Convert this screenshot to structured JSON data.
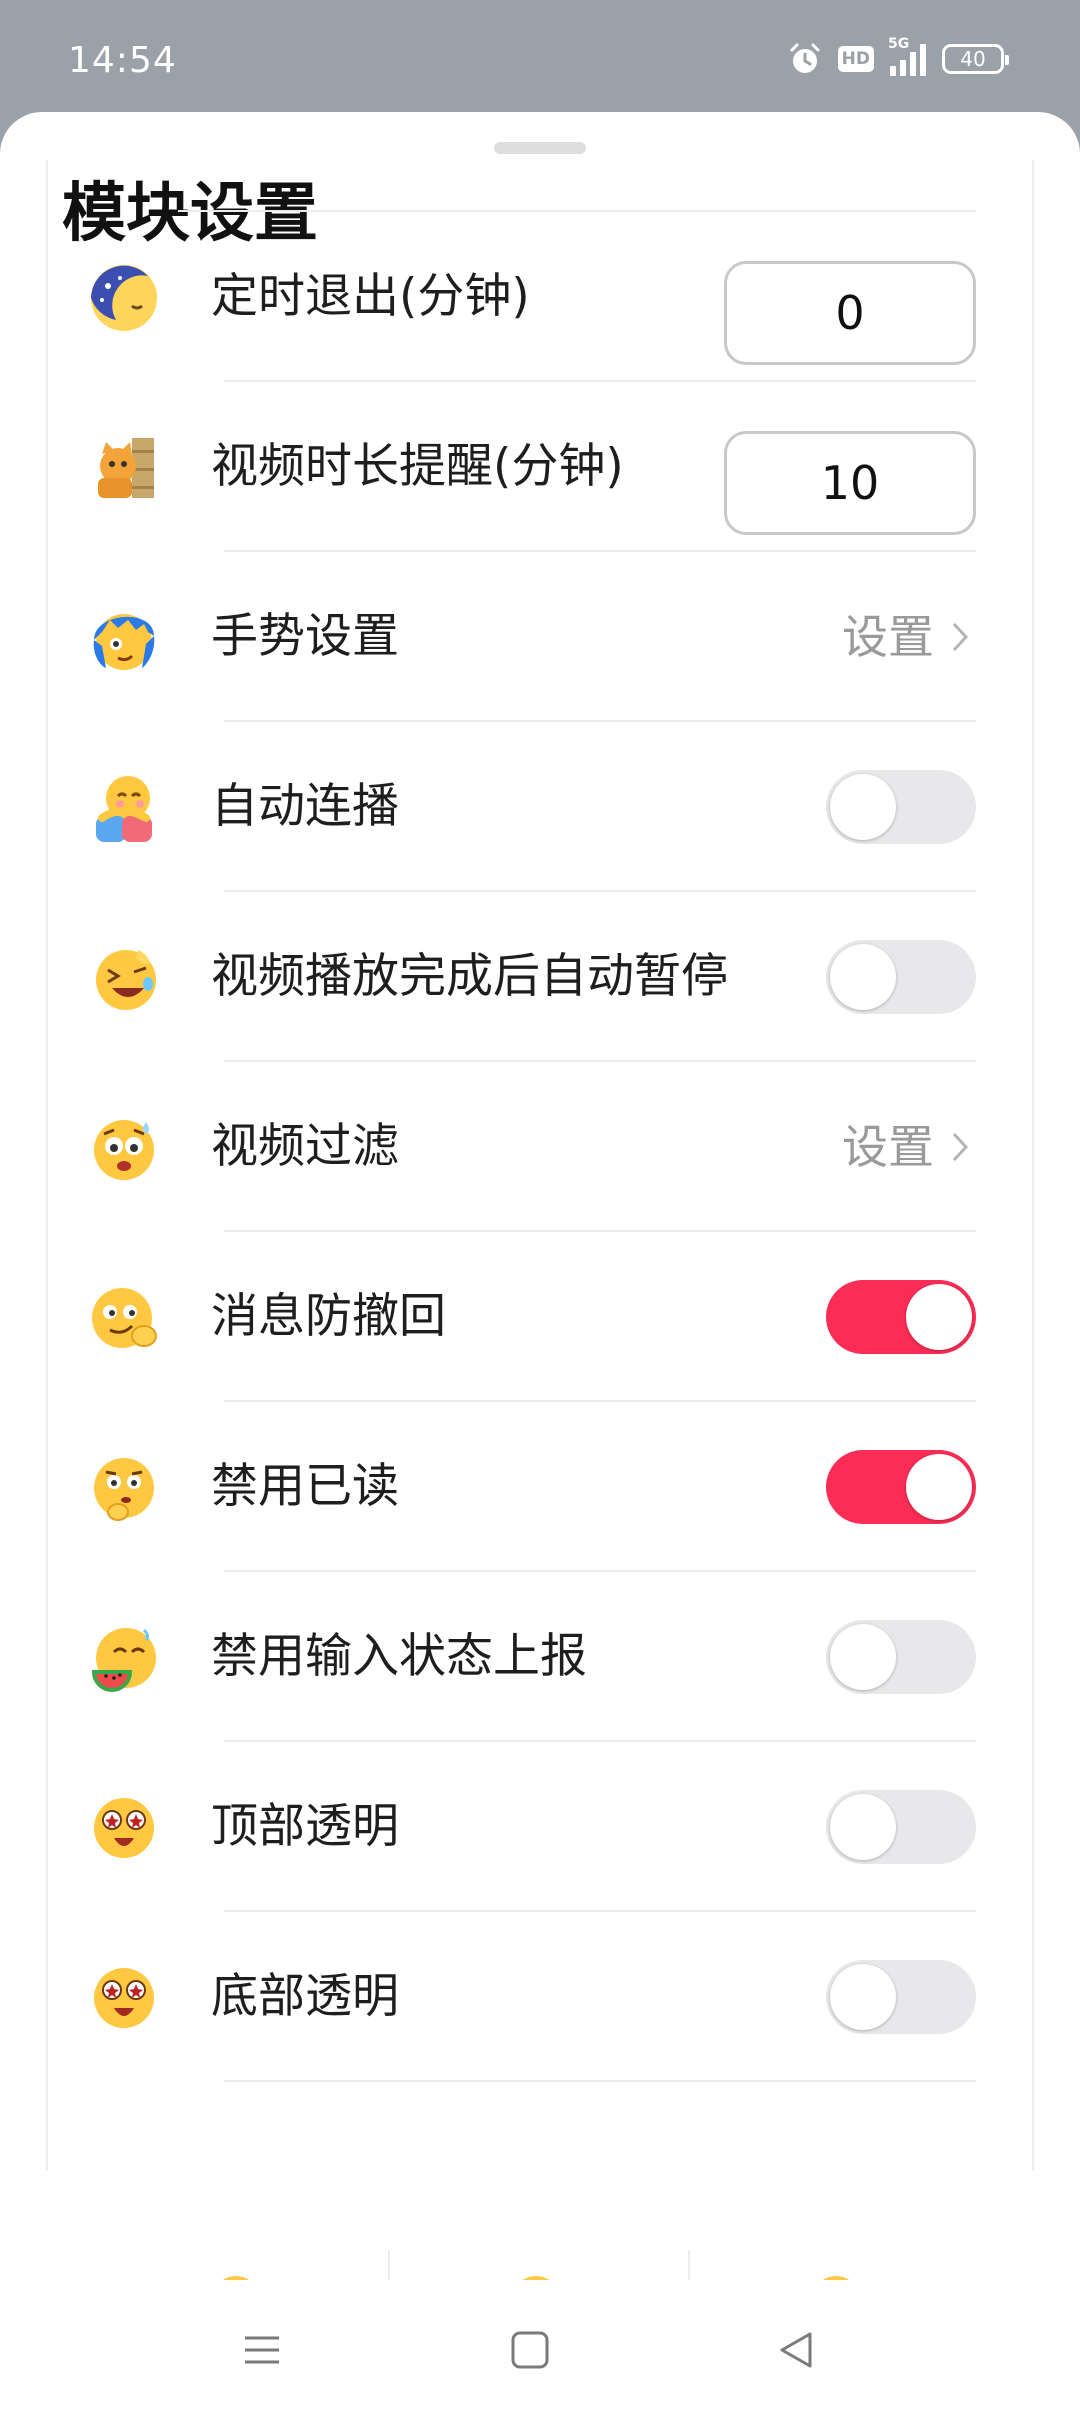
{
  "status_bar": {
    "time": "14:54",
    "network_label": "5G",
    "hd_label": "HD",
    "battery": "40"
  },
  "sheet": {
    "title": "模块设置"
  },
  "rows": [
    {
      "label": "定时退出(分钟)",
      "control": "number",
      "value": "0",
      "icon": "sleepy-moon-icon"
    },
    {
      "label": "视频时长提醒(分钟)",
      "control": "number",
      "value": "10",
      "icon": "peeking-cat-icon"
    },
    {
      "label": "手势设置",
      "control": "link",
      "link_text": "设置",
      "icon": "blue-hair-face-icon"
    },
    {
      "label": "自动连播",
      "control": "toggle",
      "on": false,
      "icon": "hug-face-icon"
    },
    {
      "label": "视频播放完成后自动暂停",
      "control": "toggle",
      "on": false,
      "icon": "laughing-face-icon"
    },
    {
      "label": "视频过滤",
      "control": "link",
      "link_text": "设置",
      "icon": "worried-face-icon"
    },
    {
      "label": "消息防撤回",
      "control": "toggle",
      "on": true,
      "icon": "smirk-face-icon"
    },
    {
      "label": "禁用已读",
      "control": "toggle",
      "on": true,
      "icon": "thinking-face-icon"
    },
    {
      "label": "禁用输入状态上报",
      "control": "toggle",
      "on": false,
      "icon": "watermelon-face-icon"
    },
    {
      "label": "顶部透明",
      "control": "toggle",
      "on": false,
      "icon": "star-eyes-face-icon"
    },
    {
      "label": "底部透明",
      "control": "toggle",
      "on": false,
      "icon": "star-eyes-face-icon"
    }
  ],
  "colors": {
    "toggle_on": "#fb2c55",
    "toggle_off": "#e8e8ea",
    "link_text": "#9a9a9a",
    "status_bar_bg": "#9aa1a8"
  },
  "nav_bar": {
    "icons": [
      "menu-icon",
      "home-square-icon",
      "back-triangle-icon"
    ]
  }
}
